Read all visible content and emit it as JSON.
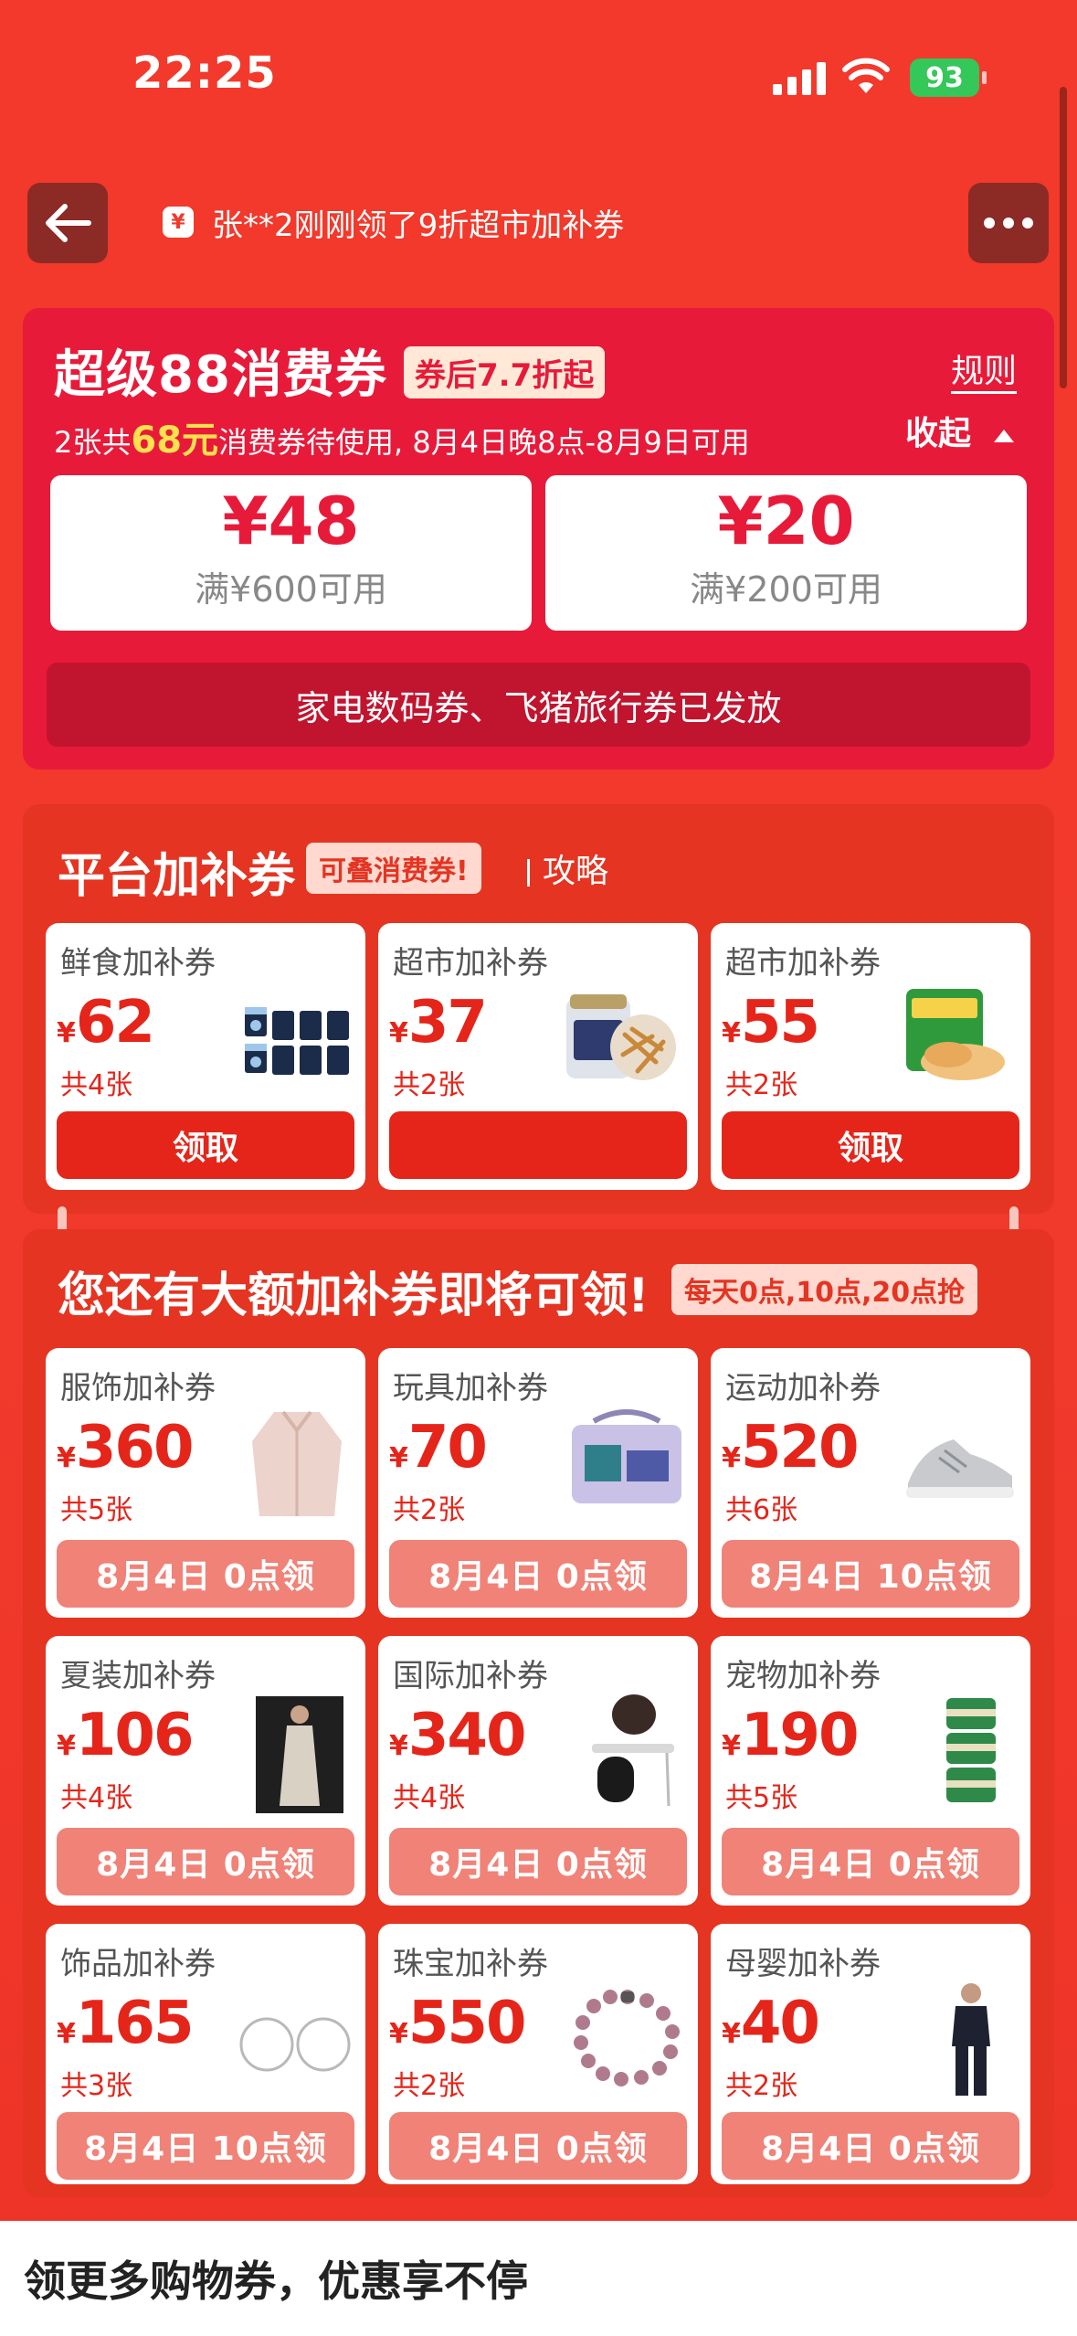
{
  "status": {
    "time": "22:25",
    "battery": "93"
  },
  "ticker": {
    "icon": "¥",
    "text": "张**2刚刚领了9折超市加补券"
  },
  "card88": {
    "title": "超级88消费券",
    "badge": "券后7.7折起",
    "rules": "规则",
    "desc_prefix": "2张共",
    "desc_amount": "68元",
    "desc_suffix": "消费券待使用, 8月4日晚8点-8月9日可用",
    "collapse": "收起",
    "coupons": [
      {
        "value": "¥48",
        "condition": "满¥600可用"
      },
      {
        "value": "¥20",
        "condition": "满¥200可用"
      }
    ],
    "released": "家电数码券、飞猪旅行券已发放"
  },
  "platform": {
    "title": "平台加补券",
    "badge": "可叠消费券!",
    "link": "攻略",
    "tiles": [
      {
        "name": "鲜食加补券",
        "value": "62",
        "count": "共4张",
        "button": "领取"
      },
      {
        "name": "超市加补券",
        "value": "37",
        "count": "共2张",
        "button": ""
      },
      {
        "name": "超市加补券",
        "value": "55",
        "count": "共2张",
        "button": "领取"
      }
    ]
  },
  "upcoming": {
    "title": "您还有大额加补券即将可领!",
    "badge": "每天0点,10点,20点抢",
    "tiles": [
      {
        "name": "服饰加补券",
        "value": "360",
        "count": "共5张",
        "button": "8月4日 0点领"
      },
      {
        "name": "玩具加补券",
        "value": "70",
        "count": "共2张",
        "button": "8月4日 0点领"
      },
      {
        "name": "运动加补券",
        "value": "520",
        "count": "共6张",
        "button": "8月4日 10点领"
      },
      {
        "name": "夏装加补券",
        "value": "106",
        "count": "共4张",
        "button": "8月4日 0点领"
      },
      {
        "name": "国际加补券",
        "value": "340",
        "count": "共4张",
        "button": "8月4日 0点领"
      },
      {
        "name": "宠物加补券",
        "value": "190",
        "count": "共5张",
        "button": "8月4日 0点领"
      },
      {
        "name": "饰品加补券",
        "value": "165",
        "count": "共3张",
        "button": "8月4日 10点领"
      },
      {
        "name": "珠宝加补券",
        "value": "550",
        "count": "共2张",
        "button": "8月4日 0点领"
      },
      {
        "name": "母婴加补券",
        "value": "40",
        "count": "共2张",
        "button": "8月4日 0点领"
      }
    ]
  },
  "currency": "¥",
  "bottom": {
    "title": "领更多购物券，优惠享不停"
  }
}
